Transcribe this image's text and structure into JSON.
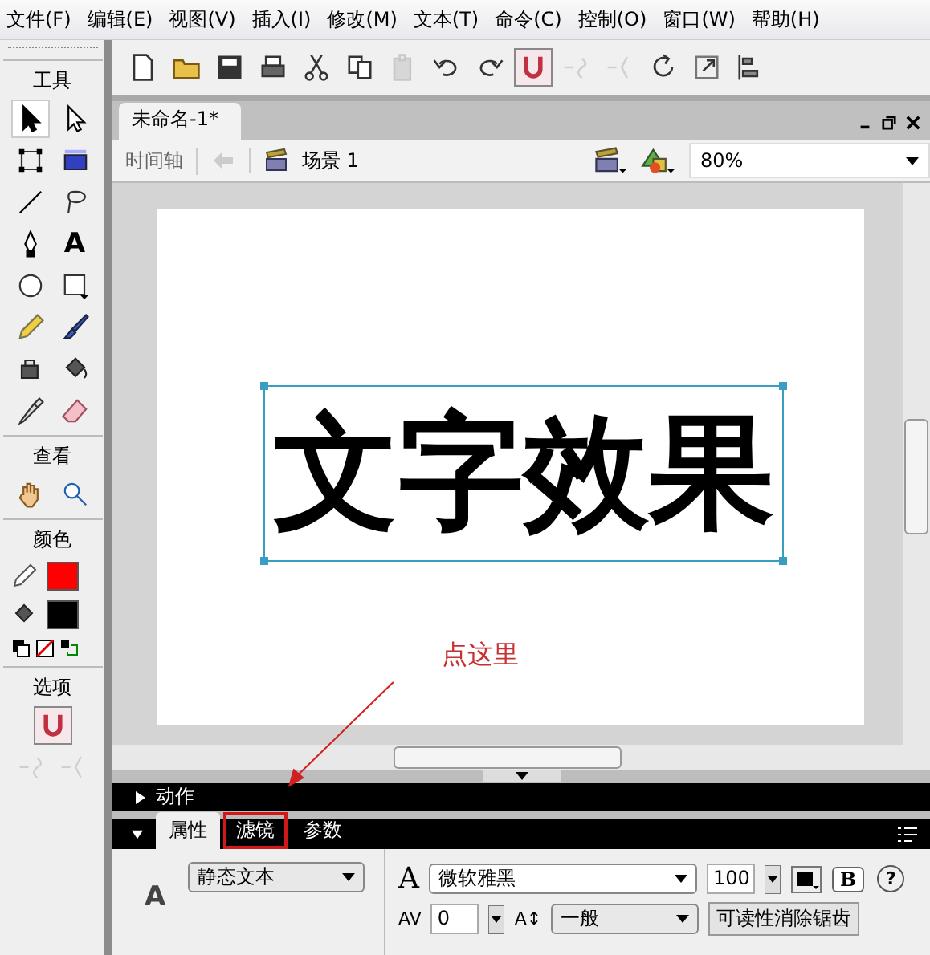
{
  "menu": [
    "文件(F)",
    "编辑(E)",
    "视图(V)",
    "插入(I)",
    "修改(M)",
    "文本(T)",
    "命令(C)",
    "控制(O)",
    "窗口(W)",
    "帮助(H)"
  ],
  "toolbar": [
    {
      "kind": "new",
      "disabled": false
    },
    {
      "kind": "open",
      "disabled": false
    },
    {
      "kind": "save",
      "disabled": false
    },
    {
      "kind": "print",
      "disabled": false
    },
    {
      "kind": "cut",
      "disabled": false
    },
    {
      "kind": "copy",
      "disabled": false
    },
    {
      "kind": "paste",
      "disabled": true
    },
    {
      "kind": "undo",
      "disabled": false
    },
    {
      "kind": "redo",
      "disabled": false
    },
    {
      "kind": "magnet",
      "disabled": false,
      "on": true
    },
    {
      "kind": "smooth",
      "disabled": true
    },
    {
      "kind": "straighten",
      "disabled": true
    },
    {
      "kind": "rotate",
      "disabled": false
    },
    {
      "kind": "scale",
      "disabled": false
    },
    {
      "kind": "align",
      "disabled": false
    }
  ],
  "toolbox": {
    "title": "工具",
    "tools": [
      {
        "kind": "arrow",
        "selected": true
      },
      {
        "kind": "subselect",
        "selected": false
      },
      {
        "kind": "transform",
        "selected": false
      },
      {
        "kind": "gradient",
        "selected": false
      },
      {
        "kind": "line",
        "selected": false
      },
      {
        "kind": "lasso",
        "selected": false
      },
      {
        "kind": "pen",
        "selected": false
      },
      {
        "kind": "text",
        "selected": false,
        "glyph": "A"
      },
      {
        "kind": "oval",
        "selected": false
      },
      {
        "kind": "rect",
        "selected": false
      },
      {
        "kind": "pencil",
        "selected": false
      },
      {
        "kind": "brush",
        "selected": false
      },
      {
        "kind": "ink",
        "selected": false
      },
      {
        "kind": "bucket",
        "selected": false
      },
      {
        "kind": "dropper",
        "selected": false
      },
      {
        "kind": "eraser",
        "selected": false
      }
    ],
    "view_title": "查看",
    "view_tools": [
      {
        "kind": "hand",
        "selected": false
      },
      {
        "kind": "zoom",
        "selected": false
      }
    ],
    "colors_title": "颜色",
    "colors": [
      {
        "kind": "stroke",
        "color": "#ff0000"
      },
      {
        "kind": "fill",
        "color": "#000000"
      }
    ],
    "options_title": "选项",
    "options": [
      {
        "kind": "magnet",
        "on": true,
        "disabled": false
      }
    ],
    "options_extra": [
      {
        "kind": "smooth",
        "disabled": true
      },
      {
        "kind": "straighten",
        "disabled": true
      }
    ]
  },
  "document": {
    "tab": "未命名-1*",
    "timeline": "时间轴",
    "scene": "场景 1",
    "zoom": "80%",
    "stage_text": "文字效果",
    "annotation": "点这里"
  },
  "panels": {
    "actions": "动作",
    "tabs": [
      {
        "label": "属性",
        "selected": true,
        "highlighted": false
      },
      {
        "label": "滤镜",
        "selected": false,
        "highlighted": true
      },
      {
        "label": "参数",
        "selected": false,
        "highlighted": false
      }
    ],
    "properties": {
      "type_glyph": "A",
      "text_type": "静态文本",
      "font_glyph": "A",
      "font": "微软雅黑",
      "size": "100",
      "bold": "B",
      "help": "?",
      "spacing_label": "AV",
      "spacing": "0",
      "position_label": "A↕",
      "position": "一般",
      "antialias": "可读性消除锯齿"
    }
  }
}
